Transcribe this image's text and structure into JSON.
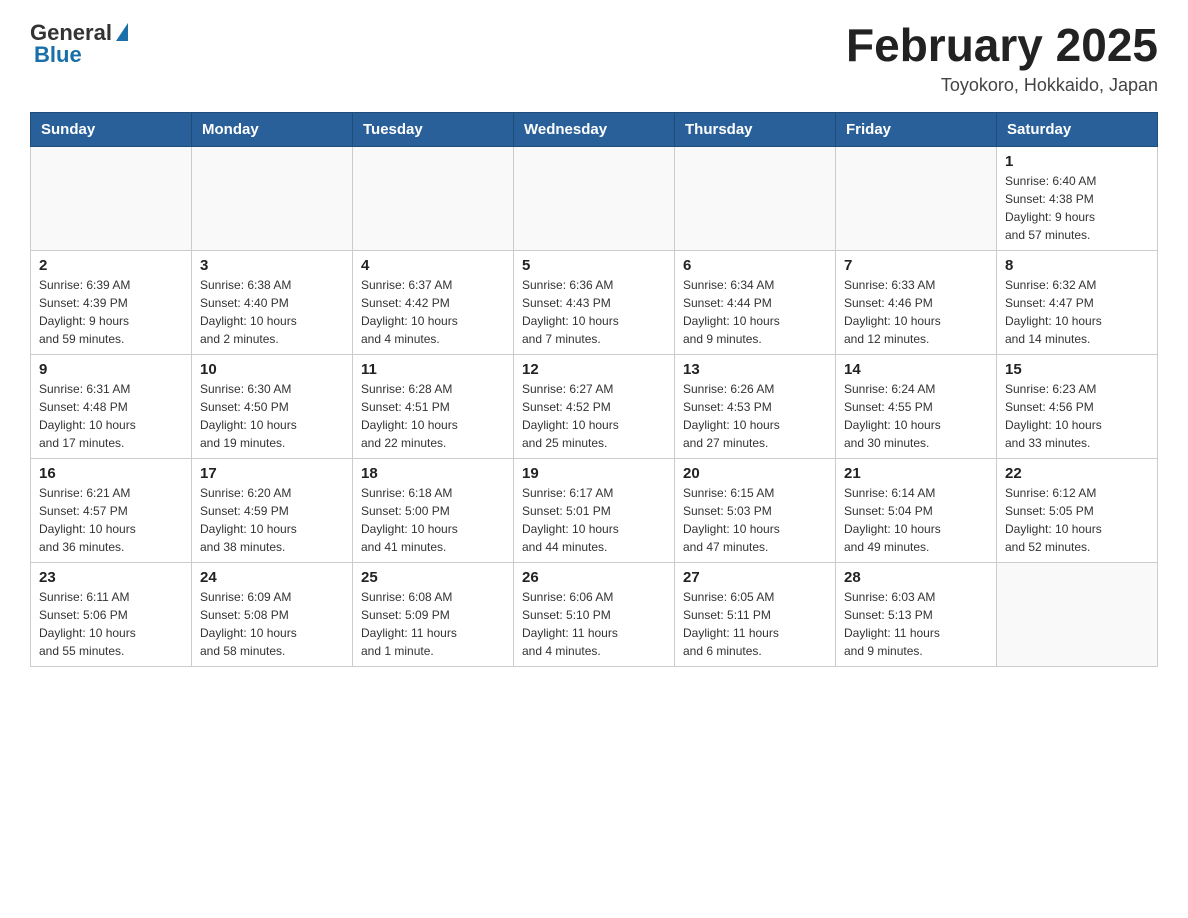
{
  "header": {
    "logo_general": "General",
    "logo_blue": "Blue",
    "month_title": "February 2025",
    "location": "Toyokoro, Hokkaido, Japan"
  },
  "weekdays": [
    "Sunday",
    "Monday",
    "Tuesday",
    "Wednesday",
    "Thursday",
    "Friday",
    "Saturday"
  ],
  "weeks": [
    [
      {
        "day": "",
        "info": ""
      },
      {
        "day": "",
        "info": ""
      },
      {
        "day": "",
        "info": ""
      },
      {
        "day": "",
        "info": ""
      },
      {
        "day": "",
        "info": ""
      },
      {
        "day": "",
        "info": ""
      },
      {
        "day": "1",
        "info": "Sunrise: 6:40 AM\nSunset: 4:38 PM\nDaylight: 9 hours\nand 57 minutes."
      }
    ],
    [
      {
        "day": "2",
        "info": "Sunrise: 6:39 AM\nSunset: 4:39 PM\nDaylight: 9 hours\nand 59 minutes."
      },
      {
        "day": "3",
        "info": "Sunrise: 6:38 AM\nSunset: 4:40 PM\nDaylight: 10 hours\nand 2 minutes."
      },
      {
        "day": "4",
        "info": "Sunrise: 6:37 AM\nSunset: 4:42 PM\nDaylight: 10 hours\nand 4 minutes."
      },
      {
        "day": "5",
        "info": "Sunrise: 6:36 AM\nSunset: 4:43 PM\nDaylight: 10 hours\nand 7 minutes."
      },
      {
        "day": "6",
        "info": "Sunrise: 6:34 AM\nSunset: 4:44 PM\nDaylight: 10 hours\nand 9 minutes."
      },
      {
        "day": "7",
        "info": "Sunrise: 6:33 AM\nSunset: 4:46 PM\nDaylight: 10 hours\nand 12 minutes."
      },
      {
        "day": "8",
        "info": "Sunrise: 6:32 AM\nSunset: 4:47 PM\nDaylight: 10 hours\nand 14 minutes."
      }
    ],
    [
      {
        "day": "9",
        "info": "Sunrise: 6:31 AM\nSunset: 4:48 PM\nDaylight: 10 hours\nand 17 minutes."
      },
      {
        "day": "10",
        "info": "Sunrise: 6:30 AM\nSunset: 4:50 PM\nDaylight: 10 hours\nand 19 minutes."
      },
      {
        "day": "11",
        "info": "Sunrise: 6:28 AM\nSunset: 4:51 PM\nDaylight: 10 hours\nand 22 minutes."
      },
      {
        "day": "12",
        "info": "Sunrise: 6:27 AM\nSunset: 4:52 PM\nDaylight: 10 hours\nand 25 minutes."
      },
      {
        "day": "13",
        "info": "Sunrise: 6:26 AM\nSunset: 4:53 PM\nDaylight: 10 hours\nand 27 minutes."
      },
      {
        "day": "14",
        "info": "Sunrise: 6:24 AM\nSunset: 4:55 PM\nDaylight: 10 hours\nand 30 minutes."
      },
      {
        "day": "15",
        "info": "Sunrise: 6:23 AM\nSunset: 4:56 PM\nDaylight: 10 hours\nand 33 minutes."
      }
    ],
    [
      {
        "day": "16",
        "info": "Sunrise: 6:21 AM\nSunset: 4:57 PM\nDaylight: 10 hours\nand 36 minutes."
      },
      {
        "day": "17",
        "info": "Sunrise: 6:20 AM\nSunset: 4:59 PM\nDaylight: 10 hours\nand 38 minutes."
      },
      {
        "day": "18",
        "info": "Sunrise: 6:18 AM\nSunset: 5:00 PM\nDaylight: 10 hours\nand 41 minutes."
      },
      {
        "day": "19",
        "info": "Sunrise: 6:17 AM\nSunset: 5:01 PM\nDaylight: 10 hours\nand 44 minutes."
      },
      {
        "day": "20",
        "info": "Sunrise: 6:15 AM\nSunset: 5:03 PM\nDaylight: 10 hours\nand 47 minutes."
      },
      {
        "day": "21",
        "info": "Sunrise: 6:14 AM\nSunset: 5:04 PM\nDaylight: 10 hours\nand 49 minutes."
      },
      {
        "day": "22",
        "info": "Sunrise: 6:12 AM\nSunset: 5:05 PM\nDaylight: 10 hours\nand 52 minutes."
      }
    ],
    [
      {
        "day": "23",
        "info": "Sunrise: 6:11 AM\nSunset: 5:06 PM\nDaylight: 10 hours\nand 55 minutes."
      },
      {
        "day": "24",
        "info": "Sunrise: 6:09 AM\nSunset: 5:08 PM\nDaylight: 10 hours\nand 58 minutes."
      },
      {
        "day": "25",
        "info": "Sunrise: 6:08 AM\nSunset: 5:09 PM\nDaylight: 11 hours\nand 1 minute."
      },
      {
        "day": "26",
        "info": "Sunrise: 6:06 AM\nSunset: 5:10 PM\nDaylight: 11 hours\nand 4 minutes."
      },
      {
        "day": "27",
        "info": "Sunrise: 6:05 AM\nSunset: 5:11 PM\nDaylight: 11 hours\nand 6 minutes."
      },
      {
        "day": "28",
        "info": "Sunrise: 6:03 AM\nSunset: 5:13 PM\nDaylight: 11 hours\nand 9 minutes."
      },
      {
        "day": "",
        "info": ""
      }
    ]
  ]
}
